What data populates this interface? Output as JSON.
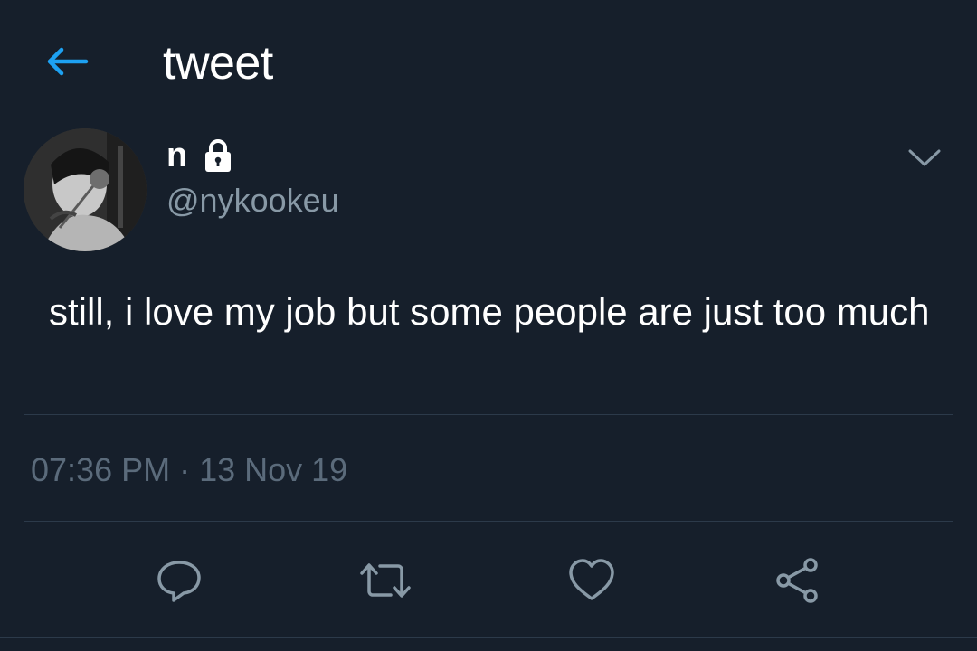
{
  "header": {
    "back_icon": "arrow-left-icon",
    "title": "tweet"
  },
  "tweet": {
    "author": {
      "display_name": "n",
      "protected_icon": "lock-icon",
      "handle": "@nykookeu",
      "avatar": "avatar-photo"
    },
    "menu_icon": "chevron-down-icon",
    "text": "still, i love my job but some people are just too much",
    "timestamp": "07:36 PM · 13 Nov 19",
    "actions": [
      {
        "name": "reply",
        "icon": "speech-bubble-icon"
      },
      {
        "name": "retweet",
        "icon": "retweet-icon"
      },
      {
        "name": "like",
        "icon": "heart-icon"
      },
      {
        "name": "share",
        "icon": "share-icon"
      }
    ]
  },
  "colors": {
    "background": "#161f2b",
    "accent": "#1da1f2",
    "secondary_text": "#8899a6",
    "muted_text": "#5b6b7b",
    "icon": "#8899a6",
    "divider": "#2c3a4a"
  }
}
